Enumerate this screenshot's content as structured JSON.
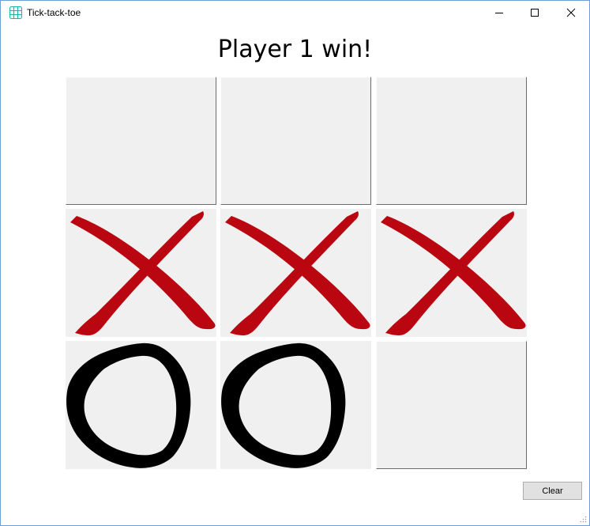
{
  "window": {
    "title": "Tick-tack-toe",
    "app_icon": "grid-app-icon",
    "controls": [
      "minimize-icon",
      "maximize-icon",
      "close-icon"
    ]
  },
  "status": {
    "message": "Player 1 win!"
  },
  "board": {
    "rows": [
      [
        "",
        "",
        ""
      ],
      [
        "X",
        "X",
        "X"
      ],
      [
        "O",
        "O",
        ""
      ]
    ],
    "colors": {
      "x": "#b90610",
      "o": "#000000",
      "empty_cell": "#f0f0f0"
    }
  },
  "buttons": {
    "clear_label": "Clear"
  }
}
